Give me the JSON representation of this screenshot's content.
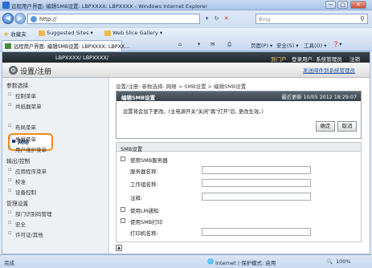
{
  "window": {
    "title": "远程用户界面: 编辑SMB设置: LBPXXXX: LBPXXXX - Windows Internet Explorer",
    "minimize": "−",
    "maximize": "□",
    "close": "✕"
  },
  "address_bar": {
    "back": "◀",
    "forward": "▶",
    "url": "http://",
    "dropdown": "▾",
    "refresh": "↻",
    "stop": "✕",
    "search_placeholder": "Bing",
    "search_icon": "⚲"
  },
  "favorites_bar": {
    "favorites": "收藏夹",
    "suggested_sites": "Suggested Sites ▾",
    "web_slice": "Web Slice Gallery ▾"
  },
  "tab": {
    "title": "远程用户界面: 编辑SMB设置: LBPXXXX: LBPXX..."
  },
  "command_bar": {
    "home": "⌂",
    "feeds": "▾",
    "mail": "✉",
    "print": "⎙",
    "page": "页面(P) ▾",
    "safety": "安全(S) ▾",
    "tools": "工具(O) ▾",
    "help": "❓▾"
  },
  "header": {
    "product": "LBPXXXX/ LBPXXXX/",
    "to_portal": "到门户",
    "login_user": "登录用户: 系统管理员",
    "logout": "注销",
    "page_title": "设置/注册",
    "mail_admin": "发送邮件到系统管理员"
  },
  "sidebar": {
    "sections": [
      {
        "label": "参数选择",
        "items": [
          "控制菜单",
          "共纸器菜单",
          "网络",
          "布局菜单",
          "质量菜单",
          "用户维护菜单"
        ]
      },
      {
        "label": "输出/控制",
        "items": [
          "应用程序菜单",
          "校准",
          "设备控制"
        ]
      },
      {
        "label": "管理设置",
        "items": [
          "部门识别码管理",
          "安全",
          "许可证/其他"
        ]
      }
    ],
    "active": "网络"
  },
  "breadcrumb": "设置/注册: 参数选择: 网络 > SMB设置 > 编辑SMB设置",
  "panel": {
    "title": "编辑SMB设置",
    "timestamp": "最近更新 10/05 2012 18:29:07",
    "message": "设置将会加下更改。(主电源开关\"关闭\"再\"打开\"后, 更改生效。)",
    "ok": "确定",
    "cancel": "取消"
  },
  "smb": {
    "section_title": "SMB设置",
    "use_smb_server": "使用SMB服务器",
    "server_name": "服务器名称:",
    "workgroup": "工作组名称:",
    "comment": "注释:",
    "use_lm": "使用LM通知",
    "use_smb_print": "使用SMB打印",
    "printer_name": "打印机名称:"
  },
  "up_button": "▲",
  "status_bar": {
    "status": "完成",
    "zone": "Internet | 保护模式: 启用",
    "zoom": "100%"
  }
}
